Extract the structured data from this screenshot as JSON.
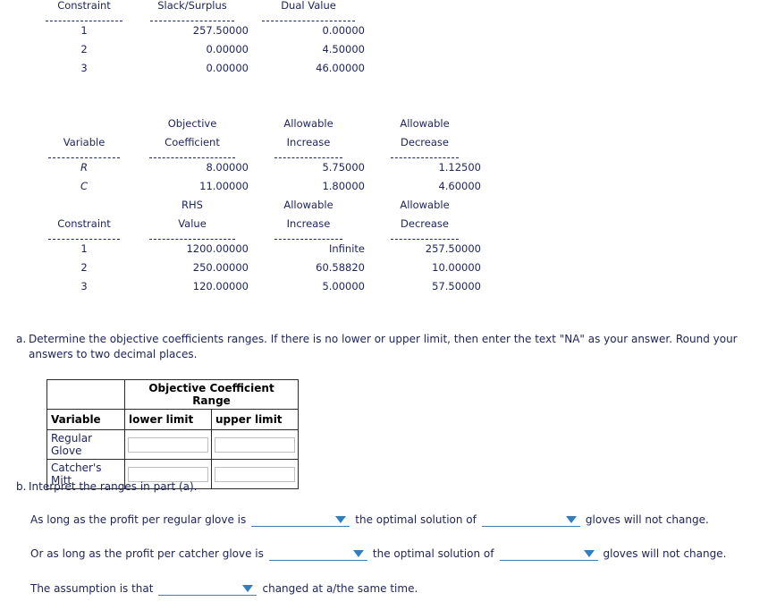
{
  "report_tables": [
    {
      "id": "slack-dual-table",
      "headers": [
        {
          "lines": [
            "Constraint"
          ],
          "align": "center"
        },
        {
          "lines": [
            "Slack/Surplus"
          ],
          "align": "center"
        },
        {
          "lines": [
            "Dual Value"
          ],
          "align": "center"
        }
      ],
      "rows": [
        [
          "1",
          "257.50000",
          "0.00000"
        ],
        [
          "2",
          "0.00000",
          "4.50000"
        ],
        [
          "3",
          "0.00000",
          "46.00000"
        ]
      ]
    },
    {
      "id": "objective-coefficient-table",
      "headers": [
        {
          "lines": [
            "",
            "Variable"
          ],
          "align": "center"
        },
        {
          "lines": [
            "Objective",
            "Coefficient"
          ],
          "align": "center"
        },
        {
          "lines": [
            "Allowable",
            "Increase"
          ],
          "align": "center"
        },
        {
          "lines": [
            "Allowable",
            "Decrease"
          ],
          "align": "center"
        }
      ],
      "rows": [
        [
          "R",
          "8.00000",
          "5.75000",
          "1.12500"
        ],
        [
          "C",
          "11.00000",
          "1.80000",
          "4.60000"
        ]
      ]
    },
    {
      "id": "rhs-range-table",
      "headers": [
        {
          "lines": [
            "",
            "Constraint"
          ],
          "align": "center"
        },
        {
          "lines": [
            "RHS",
            "Value"
          ],
          "align": "center"
        },
        {
          "lines": [
            "Allowable",
            "Increase"
          ],
          "align": "center"
        },
        {
          "lines": [
            "Allowable",
            "Decrease"
          ],
          "align": "center"
        }
      ],
      "rows": [
        [
          "1",
          "1200.00000",
          "Infinite",
          "257.50000"
        ],
        [
          "2",
          "250.00000",
          "60.58820",
          "10.00000"
        ],
        [
          "3",
          "120.00000",
          "5.00000",
          "57.50000"
        ]
      ]
    }
  ],
  "question_a": {
    "letter": "a.",
    "text": "Determine the objective coefficients ranges. If there is no lower or upper limit, then enter the text \"NA\" as your answer. Round your answers to two decimal places."
  },
  "answer_table": {
    "corner_label": "",
    "group_header": "Objective Coefficient Range",
    "col_variable": "Variable",
    "col_lower": "lower limit",
    "col_upper": "upper limit",
    "rows": [
      {
        "variable": "Regular Glove",
        "lower_value": "",
        "upper_value": ""
      },
      {
        "variable": "Catcher's Mitt",
        "lower_value": "",
        "upper_value": ""
      }
    ]
  },
  "question_b": {
    "letter": "b.",
    "text": "Interpret the ranges in part (a)."
  },
  "interpret_rows": [
    {
      "id": "regular-glove-row",
      "lead": "As long as the profit per regular glove is",
      "dropdown1_value": "",
      "middle": "the optimal solution of",
      "dropdown2_value": "",
      "tail": "gloves will not change."
    },
    {
      "id": "catcher-glove-row",
      "lead": "Or as long as the profit per catcher glove is",
      "dropdown1_value": "",
      "middle": "the optimal solution of",
      "dropdown2_value": "",
      "tail": "gloves will not change."
    }
  ],
  "assumption_row": {
    "lead": "The assumption is that",
    "dropdown_value": "",
    "tail": "changed at a/the same time."
  },
  "colors": {
    "text": "#20255c",
    "header_black": "#000000",
    "dropdown_accent": "#2f7fc1",
    "dropdown_underline": "#3d7fb5",
    "table_border": "#2b2b2b",
    "input_border": "#bfbfbf",
    "background": "#ffffff"
  }
}
